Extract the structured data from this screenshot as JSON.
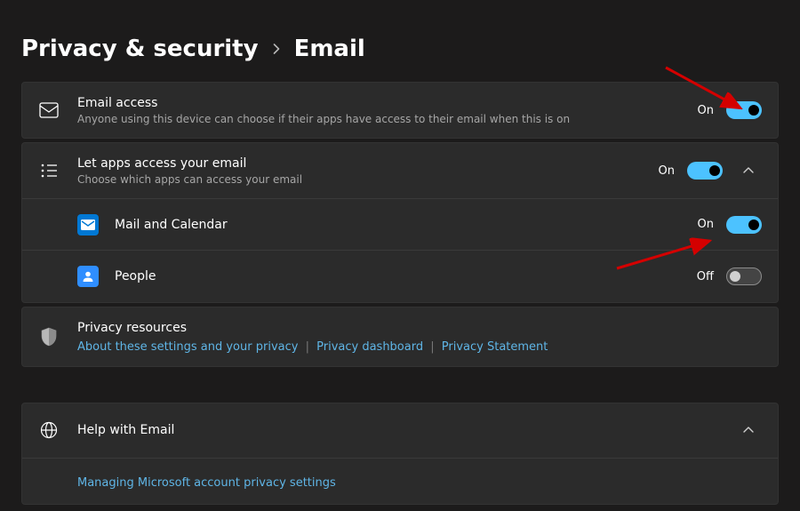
{
  "breadcrumb": {
    "parent": "Privacy & security",
    "current": "Email"
  },
  "emailAccess": {
    "title": "Email access",
    "subtitle": "Anyone using this device can choose if their apps have access to their email when this is on",
    "state": "On"
  },
  "letApps": {
    "title": "Let apps access your email",
    "subtitle": "Choose which apps can access your email",
    "state": "On"
  },
  "apps": {
    "mail": {
      "name": "Mail and Calendar",
      "state": "On"
    },
    "people": {
      "name": "People",
      "state": "Off"
    }
  },
  "privacyResources": {
    "title": "Privacy resources",
    "links": {
      "about": "About these settings and your privacy",
      "dashboard": "Privacy dashboard",
      "statement": "Privacy Statement"
    }
  },
  "help": {
    "title": "Help with Email",
    "link": "Managing Microsoft account privacy settings"
  }
}
